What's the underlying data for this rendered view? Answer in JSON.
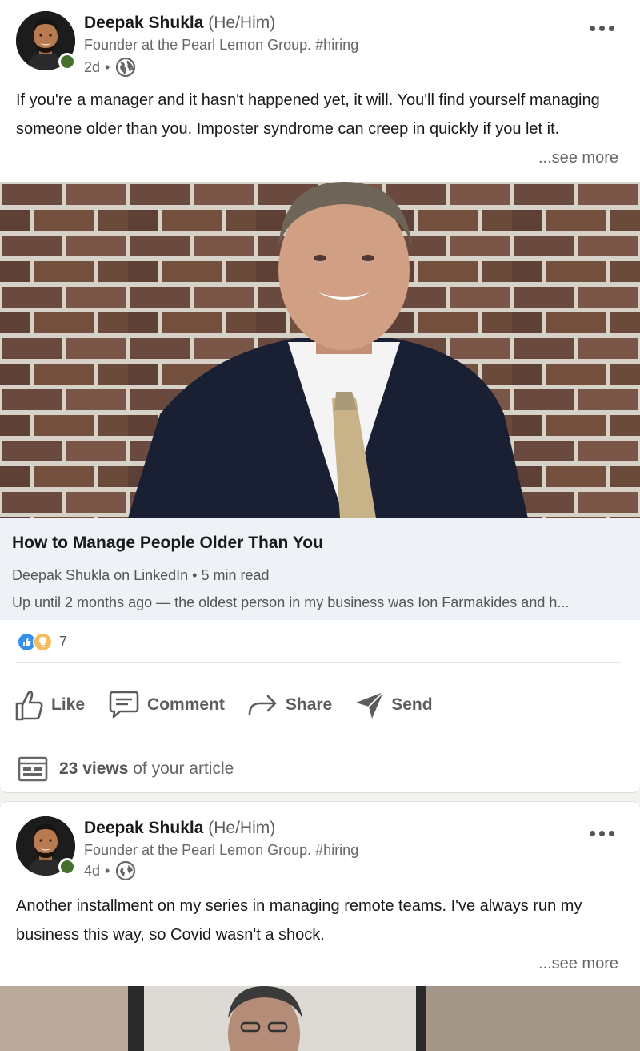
{
  "posts": [
    {
      "author": {
        "name": "Deepak Shukla",
        "pronouns": "(He/Him)",
        "headline": "Founder at the Pearl Lemon Group. #hiring"
      },
      "time": "2d",
      "meta_separator": "•",
      "text": "If you're a manager and it hasn't happened yet, it will. You'll find yourself managing someone older than you. Imposter syndrome can creep in quickly if you let it.",
      "see_more": "...see more",
      "article": {
        "title": "How to Manage People Older Than You",
        "byline": "Deepak Shukla on LinkedIn • 5 min read",
        "snippet": "Up until 2 months ago — the oldest person in my business was Ion Farmakides and h..."
      },
      "reactions": {
        "icons": [
          "like-reaction-icon",
          "insightful-reaction-icon"
        ],
        "count": "7"
      },
      "actions": {
        "like": "Like",
        "comment": "Comment",
        "share": "Share",
        "send": "Send"
      },
      "views": {
        "count": "23 views",
        "suffix": " of your article"
      }
    },
    {
      "author": {
        "name": "Deepak Shukla",
        "pronouns": "(He/Him)",
        "headline": "Founder at the Pearl Lemon Group. #hiring"
      },
      "time": "4d",
      "meta_separator": "•",
      "text": "Another installment on my series in managing remote teams. I've always run my business this way, so Covid wasn't a shock.",
      "see_more": "...see more"
    }
  ],
  "colors": {
    "presence": "#44712e",
    "article_bg": "#eef2f7",
    "like_blue": "#378fe9",
    "insight_yellow": "#f5bb5c"
  }
}
